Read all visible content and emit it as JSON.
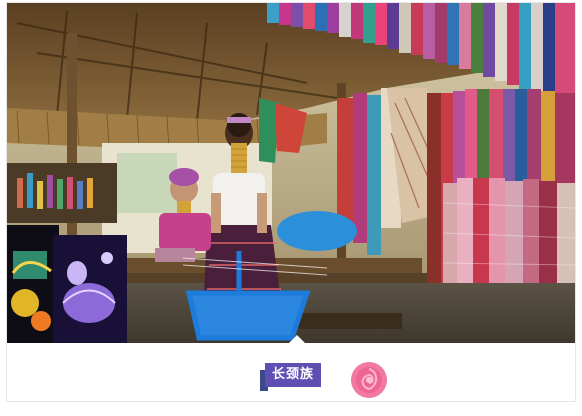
{
  "photo": {
    "subject": "village-market-scene-photo"
  },
  "caption": {
    "label": "长颈族"
  },
  "decoration": {
    "icon": "rose-icon",
    "color": "#f06b9a"
  },
  "colors": {
    "tag_background": "#5f4fb3",
    "tag_shadow": "#3c4a8c"
  }
}
